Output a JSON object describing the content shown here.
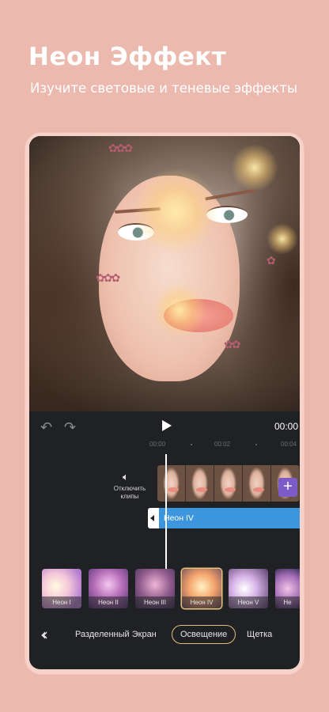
{
  "headline": "Неон Эффект",
  "subline": "Изучите световые и теневые эффекты",
  "editor": {
    "undo_icon": "undo-icon",
    "redo_icon": "redo-icon",
    "play_icon": "play-icon",
    "current_time": "00:00",
    "ruler": [
      "00:00",
      "00:02",
      "00:04"
    ],
    "mute": {
      "icon": "speaker-icon",
      "label": "Отключить клипы"
    },
    "add_label": "+",
    "effect_track": {
      "label": "Неон IV"
    },
    "effects": [
      {
        "label": "Неон I"
      },
      {
        "label": "Неон II"
      },
      {
        "label": "Неон III"
      },
      {
        "label": "Неон IV",
        "selected": true
      },
      {
        "label": "Неон V"
      },
      {
        "label": "Не"
      }
    ],
    "toolbar": {
      "back_icon": "double-chevron-left-icon",
      "back_glyph": "‹‹",
      "items": [
        "Разделенный Экран",
        "Освещение",
        "Щетка"
      ],
      "active": "Освещение"
    }
  },
  "colors": {
    "background": "#ECB9AE",
    "panel": "#202124",
    "effect_track": "#3d96dd",
    "add_button": "#7d5bc9",
    "active_border": "#e2c07a"
  }
}
